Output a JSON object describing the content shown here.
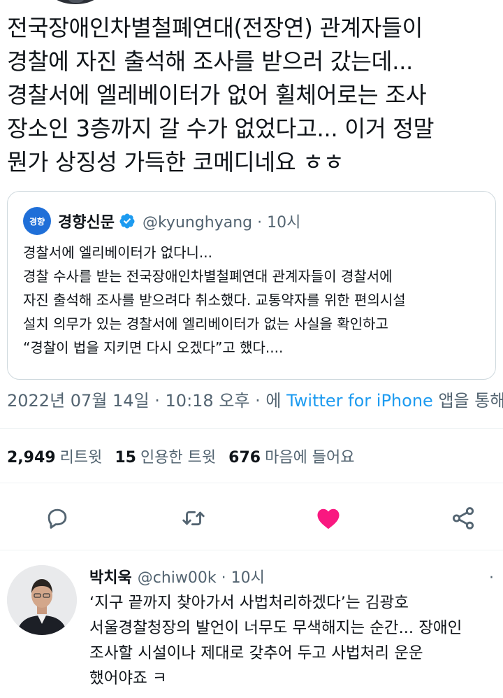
{
  "tweet": {
    "lines": [
      "전국장애인차별철폐연대(전장연) 관계자들이",
      "경찰에 자진 출석해 조사를 받으러 갔는데...",
      "경찰서에 엘레베이터가 없어 휠체어로는 조사",
      "장소인 3층까지 갈 수가 없었다고... 이거 정말",
      "뭔가 상징성 가득한 코메디네요 ㅎㅎ"
    ]
  },
  "quote": {
    "avatar_text": "경향",
    "name": "경향신문",
    "handle_time": "@kyunghyang · 10시",
    "lines": [
      "경찰서에 엘리베이터가 없다니...",
      "경찰 수사를 받는 전국장애인차별철폐연대 관계자들이 경찰서에",
      "자진 출석해 조사를 받으려다 취소했다. 교통약자를 위한 편의시설",
      "설치 의무가 있는 경찰서에 엘리베이터가 없는 사실을 확인하고",
      "“경찰이 법을 지키면 다시 오겠다”고 했다...."
    ]
  },
  "meta": {
    "date_time": "2022년 07월 14일 · 10:18 오후 · 에 ",
    "client": "Twitter for iPhone",
    "suffix": " 앱을 통해"
  },
  "stats": {
    "retweets_num": "2,949",
    "retweets_label": "리트윗",
    "quotes_num": "15",
    "quotes_label": "인용한 트윗",
    "likes_num": "676",
    "likes_label": "마음에 들어요"
  },
  "colors": {
    "like": "#f91880",
    "icon": "#536471",
    "link": "#1d9bf0",
    "verified": "#1d9bf0"
  },
  "reply": {
    "name": "박치욱",
    "handle_time": "@chiw00k · 10시",
    "more": "·",
    "lines": [
      "‘지구 끝까지 찾아가서 사법처리하겠다’는 김광호",
      "서울경찰청장의 발언이 너무도 무색해지는 순간... 장애인",
      "조사할 시설이나 제대로 갖추어 두고 사법처리 운운",
      "했어야죠 ㅋ"
    ]
  }
}
